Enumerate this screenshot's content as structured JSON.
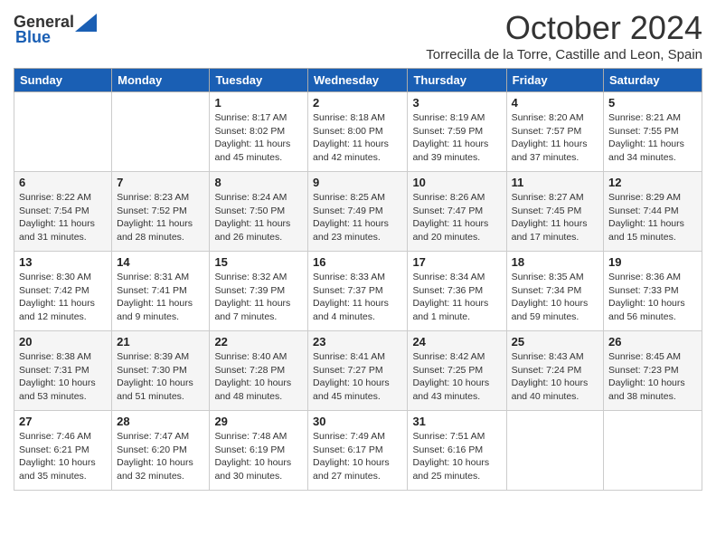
{
  "logo": {
    "general": "General",
    "blue": "Blue"
  },
  "header": {
    "title": "October 2024",
    "subtitle": "Torrecilla de la Torre, Castille and Leon, Spain"
  },
  "days_of_week": [
    "Sunday",
    "Monday",
    "Tuesday",
    "Wednesday",
    "Thursday",
    "Friday",
    "Saturday"
  ],
  "weeks": [
    [
      {
        "day": "",
        "info": ""
      },
      {
        "day": "",
        "info": ""
      },
      {
        "day": "1",
        "info": "Sunrise: 8:17 AM\nSunset: 8:02 PM\nDaylight: 11 hours and 45 minutes."
      },
      {
        "day": "2",
        "info": "Sunrise: 8:18 AM\nSunset: 8:00 PM\nDaylight: 11 hours and 42 minutes."
      },
      {
        "day": "3",
        "info": "Sunrise: 8:19 AM\nSunset: 7:59 PM\nDaylight: 11 hours and 39 minutes."
      },
      {
        "day": "4",
        "info": "Sunrise: 8:20 AM\nSunset: 7:57 PM\nDaylight: 11 hours and 37 minutes."
      },
      {
        "day": "5",
        "info": "Sunrise: 8:21 AM\nSunset: 7:55 PM\nDaylight: 11 hours and 34 minutes."
      }
    ],
    [
      {
        "day": "6",
        "info": "Sunrise: 8:22 AM\nSunset: 7:54 PM\nDaylight: 11 hours and 31 minutes."
      },
      {
        "day": "7",
        "info": "Sunrise: 8:23 AM\nSunset: 7:52 PM\nDaylight: 11 hours and 28 minutes."
      },
      {
        "day": "8",
        "info": "Sunrise: 8:24 AM\nSunset: 7:50 PM\nDaylight: 11 hours and 26 minutes."
      },
      {
        "day": "9",
        "info": "Sunrise: 8:25 AM\nSunset: 7:49 PM\nDaylight: 11 hours and 23 minutes."
      },
      {
        "day": "10",
        "info": "Sunrise: 8:26 AM\nSunset: 7:47 PM\nDaylight: 11 hours and 20 minutes."
      },
      {
        "day": "11",
        "info": "Sunrise: 8:27 AM\nSunset: 7:45 PM\nDaylight: 11 hours and 17 minutes."
      },
      {
        "day": "12",
        "info": "Sunrise: 8:29 AM\nSunset: 7:44 PM\nDaylight: 11 hours and 15 minutes."
      }
    ],
    [
      {
        "day": "13",
        "info": "Sunrise: 8:30 AM\nSunset: 7:42 PM\nDaylight: 11 hours and 12 minutes."
      },
      {
        "day": "14",
        "info": "Sunrise: 8:31 AM\nSunset: 7:41 PM\nDaylight: 11 hours and 9 minutes."
      },
      {
        "day": "15",
        "info": "Sunrise: 8:32 AM\nSunset: 7:39 PM\nDaylight: 11 hours and 7 minutes."
      },
      {
        "day": "16",
        "info": "Sunrise: 8:33 AM\nSunset: 7:37 PM\nDaylight: 11 hours and 4 minutes."
      },
      {
        "day": "17",
        "info": "Sunrise: 8:34 AM\nSunset: 7:36 PM\nDaylight: 11 hours and 1 minute."
      },
      {
        "day": "18",
        "info": "Sunrise: 8:35 AM\nSunset: 7:34 PM\nDaylight: 10 hours and 59 minutes."
      },
      {
        "day": "19",
        "info": "Sunrise: 8:36 AM\nSunset: 7:33 PM\nDaylight: 10 hours and 56 minutes."
      }
    ],
    [
      {
        "day": "20",
        "info": "Sunrise: 8:38 AM\nSunset: 7:31 PM\nDaylight: 10 hours and 53 minutes."
      },
      {
        "day": "21",
        "info": "Sunrise: 8:39 AM\nSunset: 7:30 PM\nDaylight: 10 hours and 51 minutes."
      },
      {
        "day": "22",
        "info": "Sunrise: 8:40 AM\nSunset: 7:28 PM\nDaylight: 10 hours and 48 minutes."
      },
      {
        "day": "23",
        "info": "Sunrise: 8:41 AM\nSunset: 7:27 PM\nDaylight: 10 hours and 45 minutes."
      },
      {
        "day": "24",
        "info": "Sunrise: 8:42 AM\nSunset: 7:25 PM\nDaylight: 10 hours and 43 minutes."
      },
      {
        "day": "25",
        "info": "Sunrise: 8:43 AM\nSunset: 7:24 PM\nDaylight: 10 hours and 40 minutes."
      },
      {
        "day": "26",
        "info": "Sunrise: 8:45 AM\nSunset: 7:23 PM\nDaylight: 10 hours and 38 minutes."
      }
    ],
    [
      {
        "day": "27",
        "info": "Sunrise: 7:46 AM\nSunset: 6:21 PM\nDaylight: 10 hours and 35 minutes."
      },
      {
        "day": "28",
        "info": "Sunrise: 7:47 AM\nSunset: 6:20 PM\nDaylight: 10 hours and 32 minutes."
      },
      {
        "day": "29",
        "info": "Sunrise: 7:48 AM\nSunset: 6:19 PM\nDaylight: 10 hours and 30 minutes."
      },
      {
        "day": "30",
        "info": "Sunrise: 7:49 AM\nSunset: 6:17 PM\nDaylight: 10 hours and 27 minutes."
      },
      {
        "day": "31",
        "info": "Sunrise: 7:51 AM\nSunset: 6:16 PM\nDaylight: 10 hours and 25 minutes."
      },
      {
        "day": "",
        "info": ""
      },
      {
        "day": "",
        "info": ""
      }
    ]
  ]
}
